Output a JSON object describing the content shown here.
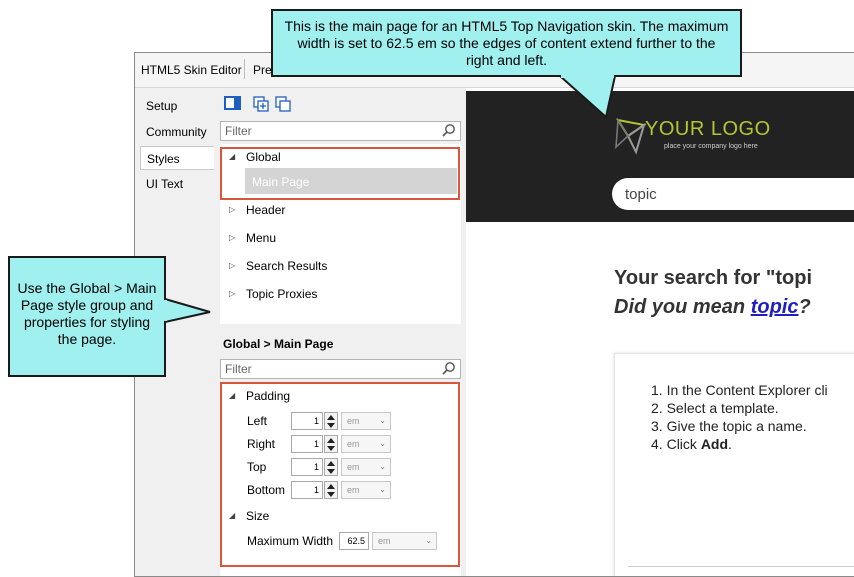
{
  "window": {
    "title": "HTML5 Skin Editor",
    "title_tab2": "Pre"
  },
  "vertical_tabs": [
    "Setup",
    "Community",
    "Styles",
    "UI Text"
  ],
  "panel": {
    "filter_placeholder": "Filter",
    "tree": {
      "global": "Global",
      "main_page": "Main Page",
      "header": "Header",
      "menu": "Menu",
      "search_results": "Search Results",
      "topic_proxies": "Topic Proxies"
    },
    "section_heading": "Global > Main Page",
    "properties_filter_placeholder": "Filter",
    "padding": {
      "group": "Padding",
      "rows": [
        {
          "label": "Left",
          "value": "1",
          "unit": "em"
        },
        {
          "label": "Right",
          "value": "1",
          "unit": "em"
        },
        {
          "label": "Top",
          "value": "1",
          "unit": "em"
        },
        {
          "label": "Bottom",
          "value": "1",
          "unit": "em"
        }
      ]
    },
    "size": {
      "group": "Size",
      "label": "Maximum Width",
      "value": "62.5",
      "unit": "em"
    }
  },
  "preview": {
    "logo_main": "YOUR LOGO",
    "logo_sub": "place your company logo here",
    "search_value": "topic",
    "heading_line1": "Your search for \"topi",
    "heading_line2_prefix": "Did you mean ",
    "heading_link": "topic",
    "heading_line2_suffix": "?",
    "steps": [
      {
        "num": "1.",
        "text": "In the Content Explorer cli"
      },
      {
        "num": "2.",
        "text": "Select a template."
      },
      {
        "num": "3.",
        "text": "Give the topic a name."
      },
      {
        "num": "4.",
        "prefix": "Click ",
        "bold": "Add",
        "suffix": "."
      }
    ]
  },
  "callouts": {
    "top": "This is the main page for an HTML5 Top Navigation skin. The maximum width is set to 62.5 em so the edges of content extend further to the right and left.",
    "left": "Use the Global > Main Page style group and properties for styling the page."
  },
  "colors": {
    "callout_fill": "#9ff0ef",
    "highlight_border": "#d9553c",
    "preview_header": "#222222",
    "logo_accent": "#b7c534",
    "link": "#1f1fbf"
  }
}
